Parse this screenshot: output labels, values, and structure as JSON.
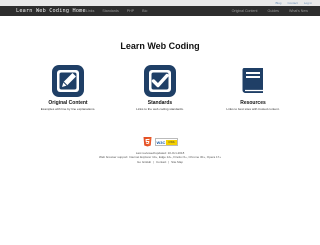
{
  "topbar": {
    "links": [
      "Blog",
      "Contact",
      "Log in"
    ]
  },
  "navbar": {
    "brand": "Learn Web Coding Home",
    "left_items": [
      "Links",
      "Standards",
      "PHP",
      "Bio"
    ],
    "right_items": [
      "Original Content",
      "Guides",
      "What's New"
    ]
  },
  "hero": {
    "title": "Learn Web Coding"
  },
  "features": [
    {
      "title": "Original Content",
      "desc": "Examples with line by line explanations.",
      "icon": "pencil-square-icon"
    },
    {
      "title": "Standards",
      "desc": "Links to the web coding standards.",
      "icon": "check-square-icon"
    },
    {
      "title": "Resources",
      "desc": "Links to best sites with trusted content.",
      "icon": "book-icon"
    }
  ],
  "badges": {
    "html5": "HTML5",
    "w3c": "W3C",
    "css": "CSS"
  },
  "footer": {
    "last_reviewed": "Last reviewed/updated: 10-Oct-2018",
    "support": "Web browser support: Internet Explorer 10+, Edge 12+, Firefox 6+, Chrome 30+, Opera 17+",
    "links": [
      "Go GitHub",
      "Contact",
      "Site Map"
    ],
    "separator": "|"
  },
  "colors": {
    "accent": "#1f3f66",
    "navbar_bg": "#2d2d2d",
    "topbar_bg": "#e9e9e9"
  }
}
